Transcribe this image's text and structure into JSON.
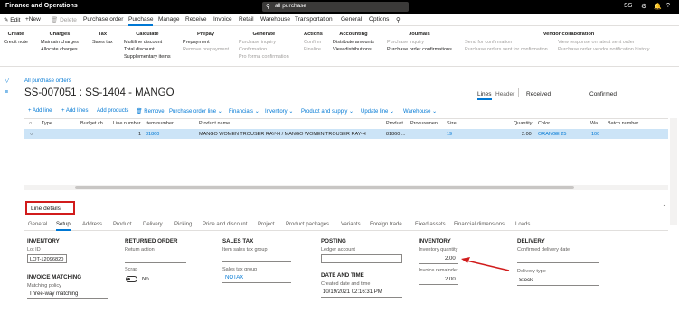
{
  "app": {
    "title": "Finance and Operations",
    "search_text": "all purchase",
    "user_initials": "SS"
  },
  "actions": {
    "edit": "Edit",
    "new": "New",
    "delete": "Delete",
    "tabs": [
      "Purchase order",
      "Purchase",
      "Manage",
      "Receive",
      "Invoice",
      "Retail",
      "Warehouse",
      "Transportation",
      "General",
      "Options"
    ]
  },
  "ribbon": {
    "create": {
      "h": "Create",
      "items": [
        "Credit note"
      ]
    },
    "charges": {
      "h": "Charges",
      "items": [
        "Maintain charges",
        "Allocate charges"
      ]
    },
    "tax": {
      "h": "Tax",
      "items": [
        "Sales tax"
      ]
    },
    "calculate": {
      "h": "Calculate",
      "items": [
        "Multiline discount",
        "Total discount",
        "Supplementary items"
      ]
    },
    "prepay": {
      "h": "Prepay",
      "items": [
        "Prepayment",
        "Remove prepayment"
      ]
    },
    "generate": {
      "h": "Generate",
      "items": [
        "Purchase inquiry",
        "Confirmation",
        "Pro forma confirmation"
      ]
    },
    "actions": {
      "h": "Actions",
      "items": [
        "Confirm",
        "Finalize"
      ]
    },
    "accounting": {
      "h": "Accounting",
      "items": [
        "Distribute amounts",
        "View distributions"
      ]
    },
    "journals": {
      "h": "Journals",
      "items": [
        "Purchase inquiry",
        "Purchase order confirmations"
      ]
    },
    "vendor": {
      "h": "Vendor collaboration",
      "items": [
        "Send for confirmation",
        "Purchase orders sent for confirmation",
        "View response on latest sent order",
        "Purchase order vendor notification history"
      ]
    }
  },
  "header": {
    "breadcrumb": "All purchase orders",
    "title": "SS-007051 : SS-1404 - MANGO",
    "view_lines": "Lines",
    "view_header": "Header",
    "status1": "Received",
    "status2": "Confirmed"
  },
  "lines_toolbar": [
    "+ Add line",
    "+ Add lines",
    "Add products",
    "Remove",
    "Purchase order line",
    "Financials",
    "Inventory",
    "Product and supply",
    "Update line",
    "Warehouse"
  ],
  "grid": {
    "headers": [
      "Type",
      "Budget ch...",
      "Line number",
      "Item number",
      "Product name",
      "Product...",
      "Procuremen...",
      "Size",
      "Quantity",
      "Color",
      "Wa...",
      "Batch number"
    ],
    "row": {
      "line": "1",
      "item": "81860",
      "product": "MANGO WOMEN TROUSER RAY-H / MANGO WOMEN TROUSER RAY-H",
      "product2": "81860 ...",
      "size": "19",
      "quantity": "2.00",
      "color": "ORANGE 25",
      "wh": "100"
    }
  },
  "line_details": {
    "label": "Line details",
    "tabs": [
      "General",
      "Setup",
      "Address",
      "Product",
      "Delivery",
      "Picking",
      "Price and discount",
      "Project",
      "Product packages",
      "Variants",
      "Foreign trade",
      "Fixed assets",
      "Financial dimensions",
      "Loads"
    ]
  },
  "setup": {
    "inventory_h": "INVENTORY",
    "lot_label": "Lot ID",
    "lot_value": "LOT-12096820",
    "matching_h": "INVOICE MATCHING",
    "matching_label": "Matching policy",
    "matching_value": "Three-way matching",
    "returned_h": "RETURNED ORDER",
    "return_label": "Return action",
    "scrap_label": "Scrap",
    "scrap_value": "No",
    "salestax_h": "SALES TAX",
    "item_tax_label": "Item sales tax group",
    "tax_group_label": "Sales tax group",
    "tax_group_value": "NOTAX",
    "posting_h": "POSTING",
    "ledger_label": "Ledger account",
    "date_h": "DATE AND TIME",
    "created_label": "Created date and time",
    "created_value": "10/19/2021 02:16:31 PM",
    "inv2_h": "INVENTORY",
    "inv_qty_label": "Inventory quantity",
    "inv_qty_value": "2.00",
    "inv_rem_label": "Invoice remainder",
    "inv_rem_value": "2.00",
    "delivery_h": "DELIVERY",
    "confirmed_label": "Confirmed delivery date",
    "delivery_type_label": "Delivery type",
    "delivery_type_value": "Stock"
  },
  "colors": {
    "accent": "#0078d4",
    "highlight": "#d11c1c",
    "selected_row": "#cce4f7"
  }
}
